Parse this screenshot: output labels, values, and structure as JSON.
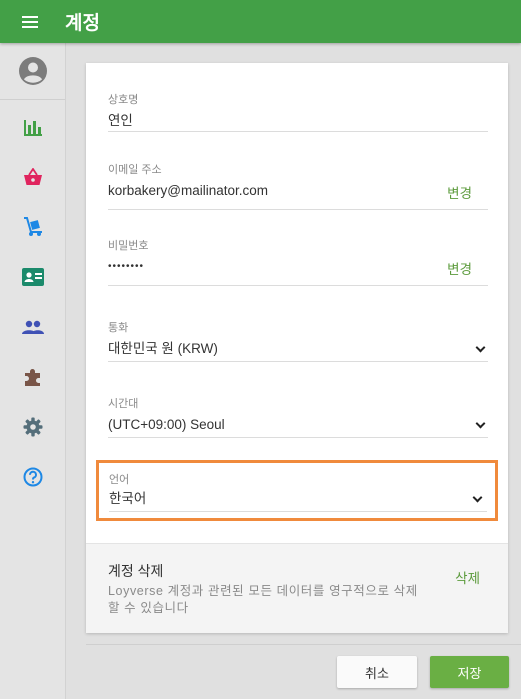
{
  "header": {
    "title": "계정"
  },
  "sidebar": {
    "items": [
      {
        "icon": "bar-chart-icon",
        "color": "#43a047"
      },
      {
        "icon": "basket-icon",
        "color": "#e0245e"
      },
      {
        "icon": "hand-truck-icon",
        "color": "#1e88e5"
      },
      {
        "icon": "id-card-icon",
        "color": "#1b8a6b"
      },
      {
        "icon": "people-icon",
        "color": "#3f51b5"
      },
      {
        "icon": "puzzle-icon",
        "color": "#795548"
      },
      {
        "icon": "gear-icon",
        "color": "#546e7a"
      },
      {
        "icon": "help-icon",
        "color": "#1e88e5"
      }
    ]
  },
  "form": {
    "business_name": {
      "label": "상호명",
      "value": "연인"
    },
    "email": {
      "label": "이메일 주소",
      "value": "korbakery@mailinator.com",
      "action": "변경"
    },
    "password": {
      "label": "비밀번호",
      "value": "••••••••",
      "action": "변경"
    },
    "currency": {
      "label": "통화",
      "value": "대한민국 원 (KRW)"
    },
    "timezone": {
      "label": "시간대",
      "value": "(UTC+09:00) Seoul"
    },
    "language": {
      "label": "언어",
      "value": "한국어"
    }
  },
  "delete_account": {
    "title": "계정 삭제",
    "description": "Loyverse 계정과 관련된 모든 데이터를 영구적으로 삭제할 수 있습니다",
    "action": "삭제"
  },
  "footer": {
    "cancel_label": "취소",
    "save_label": "저장"
  },
  "colors": {
    "brand": "#43a047",
    "link": "#5c9b3c",
    "highlight": "#f08a3c"
  }
}
